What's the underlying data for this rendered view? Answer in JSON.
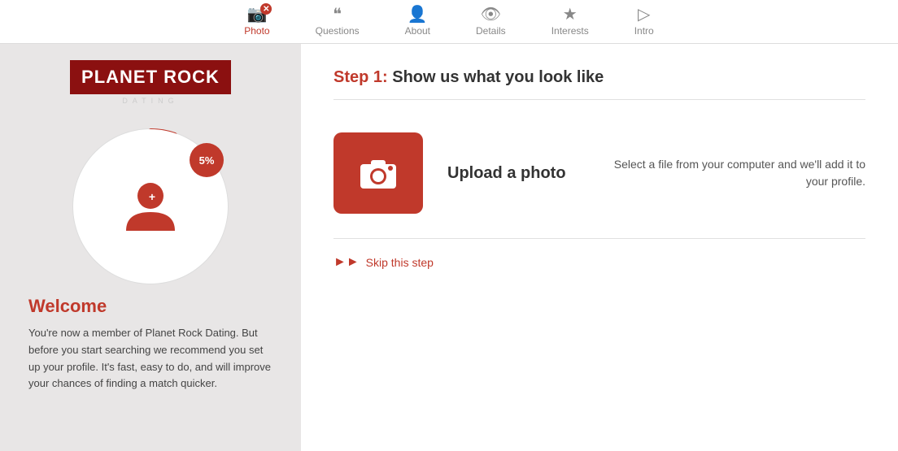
{
  "nav": {
    "items": [
      {
        "id": "photo",
        "label": "Photo",
        "icon": "📷",
        "active": true
      },
      {
        "id": "questions",
        "label": "Questions",
        "icon": "❝",
        "active": false
      },
      {
        "id": "about",
        "label": "About",
        "icon": "👤",
        "active": false
      },
      {
        "id": "details",
        "label": "Details",
        "icon": "👁",
        "active": false
      },
      {
        "id": "interests",
        "label": "Interests",
        "icon": "★",
        "active": false
      },
      {
        "id": "intro",
        "label": "Intro",
        "icon": "▷",
        "active": false
      }
    ]
  },
  "sidebar": {
    "logo_text": "PLANET ROCK",
    "logo_subtitle": "DATING",
    "progress_percent": "5%",
    "welcome_title": "Welcome",
    "welcome_body": "You're now a member of Planet Rock Dating. But before you start searching we recommend you set up your profile. It's fast, easy to do, and will improve your chances of finding a match quicker."
  },
  "main": {
    "step_number": "Step 1:",
    "step_description": "Show us what you look like",
    "upload_label": "Upload a photo",
    "upload_description": "Select a file from your computer and we'll add it to your profile.",
    "skip_label": "Skip this step"
  }
}
